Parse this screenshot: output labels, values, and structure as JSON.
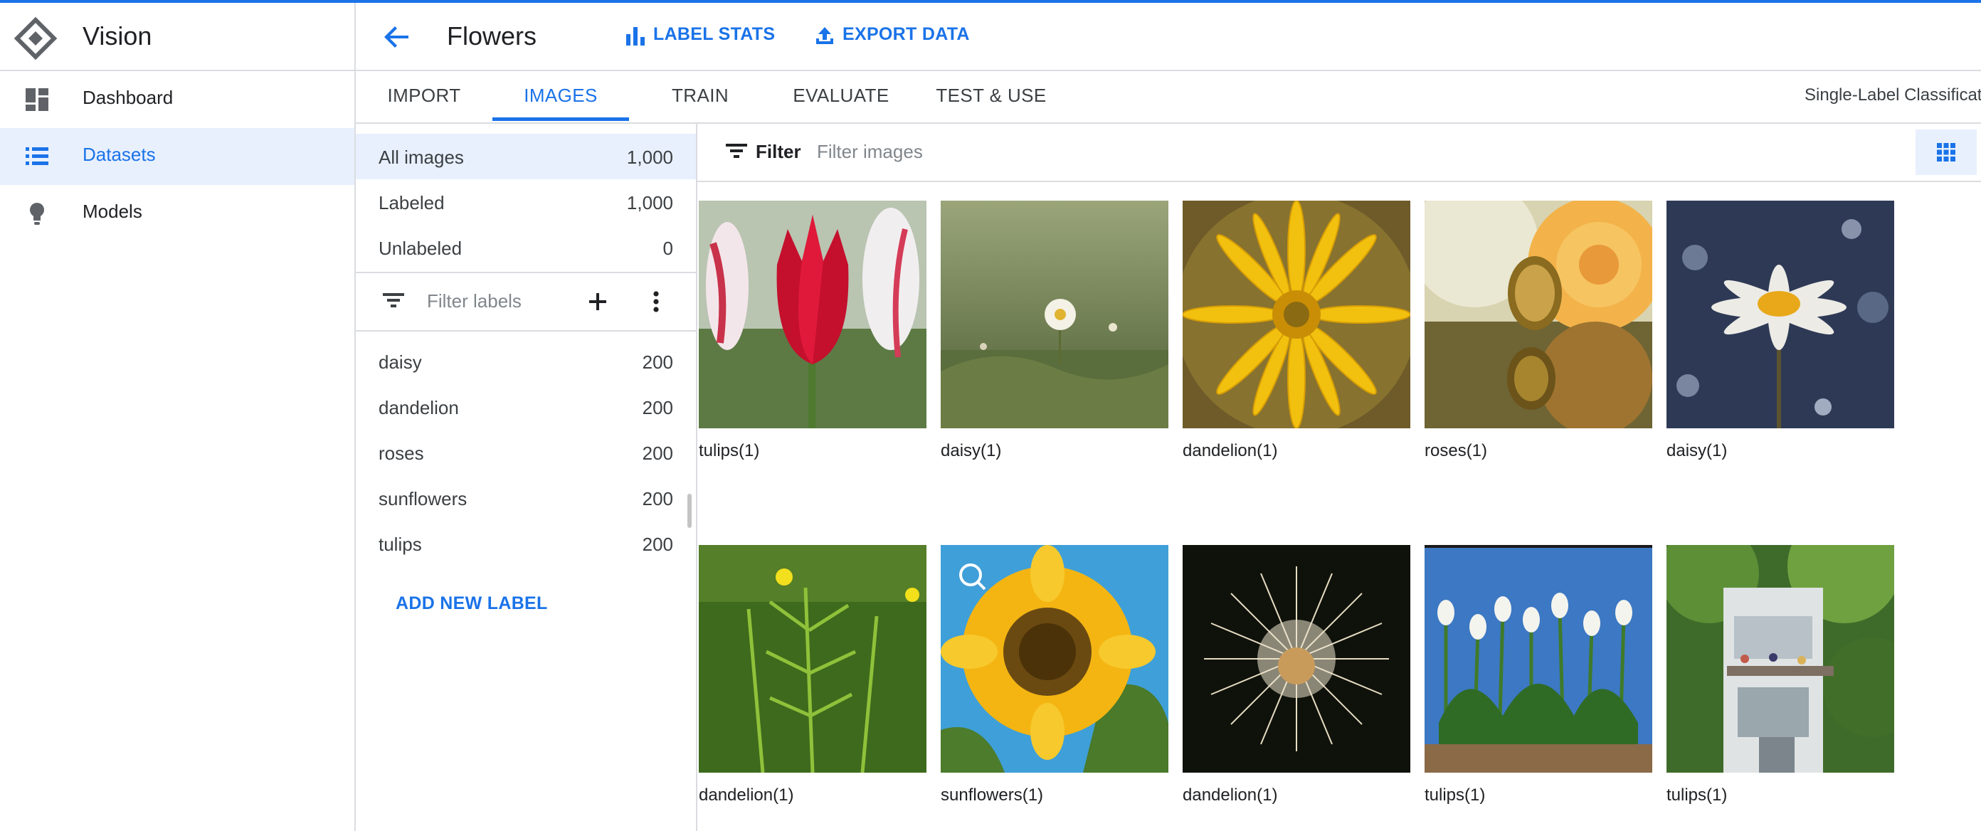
{
  "app": {
    "title": "Vision"
  },
  "nav": {
    "items": [
      {
        "label": "Dashboard",
        "icon": "dashboard-icon"
      },
      {
        "label": "Datasets",
        "icon": "list-icon",
        "active": true
      },
      {
        "label": "Models",
        "icon": "lightbulb-icon"
      }
    ]
  },
  "header": {
    "dataset_title": "Flowers",
    "label_stats": "LABEL STATS",
    "export_data": "EXPORT DATA"
  },
  "tabs": [
    {
      "label": "IMPORT"
    },
    {
      "label": "IMAGES",
      "active": true
    },
    {
      "label": "TRAIN"
    },
    {
      "label": "EVALUATE"
    },
    {
      "label": "TEST & USE"
    }
  ],
  "mode_text": "Single-Label Classificat",
  "image_filters": [
    {
      "label": "All images",
      "count": "1,000",
      "selected": true
    },
    {
      "label": "Labeled",
      "count": "1,000"
    },
    {
      "label": "Unlabeled",
      "count": "0"
    }
  ],
  "label_filter": {
    "placeholder": "Filter labels"
  },
  "labels": [
    {
      "name": "daisy",
      "count": "200"
    },
    {
      "name": "dandelion",
      "count": "200"
    },
    {
      "name": "roses",
      "count": "200"
    },
    {
      "name": "sunflowers",
      "count": "200"
    },
    {
      "name": "tulips",
      "count": "200"
    }
  ],
  "add_label": "ADD NEW LABEL",
  "grid_filter": {
    "label": "Filter",
    "placeholder": "Filter images"
  },
  "images": [
    {
      "caption": "tulips(1)",
      "kind": "tulip-red"
    },
    {
      "caption": "daisy(1)",
      "kind": "daisy-field"
    },
    {
      "caption": "dandelion(1)",
      "kind": "dandelion-yellow"
    },
    {
      "caption": "roses(1)",
      "kind": "rose-yellow"
    },
    {
      "caption": "daisy(1)",
      "kind": "daisy-bokeh"
    },
    {
      "caption": "dandelion(1)",
      "kind": "green-stems"
    },
    {
      "caption": "sunflowers(1)",
      "kind": "sunflower"
    },
    {
      "caption": "dandelion(1)",
      "kind": "dandelion-puff"
    },
    {
      "caption": "tulips(1)",
      "kind": "tulips-white"
    },
    {
      "caption": "tulips(1)",
      "kind": "building-garden"
    }
  ],
  "colors": {
    "accent": "#1a73e8",
    "selected_bg": "#e8f0fe",
    "divider": "#dadce0"
  }
}
